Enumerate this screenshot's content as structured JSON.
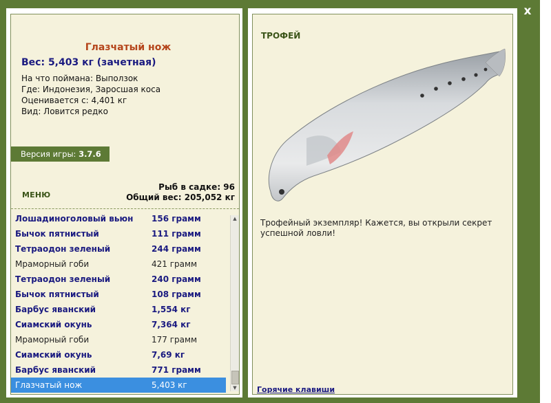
{
  "close": {
    "label": "x"
  },
  "fish": {
    "name": "Глазчатый нож",
    "weight_line": "Вес: 5,403 кг (зачетная)",
    "bait": "На что поймана: Выползок",
    "place": "Где: Индонезия, Заросшая коса",
    "rated": "Оценивается с: 4,401 кг",
    "kind": "Вид: Ловится редко"
  },
  "version": {
    "label": "Версия игры:",
    "value": "3.7.6"
  },
  "menu": {
    "label": "МЕНЮ"
  },
  "stats": {
    "fish_count": "Рыб в садке: 96",
    "total_weight": "Общий вес: 205,052 кг"
  },
  "catch_list": [
    {
      "name": "Лошадиноголовый вьюн",
      "weight": "156 грамм",
      "style": "b"
    },
    {
      "name": "Бычок пятнистый",
      "weight": "111 грамм",
      "style": "b"
    },
    {
      "name": "Тетраодон зеленый",
      "weight": "244 грамм",
      "style": "b"
    },
    {
      "name": "Мраморный гоби",
      "weight": "421 грамм",
      "style": "n"
    },
    {
      "name": "Тетраодон зеленый",
      "weight": "240 грамм",
      "style": "b"
    },
    {
      "name": "Бычок пятнистый",
      "weight": "108 грамм",
      "style": "b"
    },
    {
      "name": "Барбус яванский",
      "weight": "1,554 кг",
      "style": "b"
    },
    {
      "name": "Сиамский окунь",
      "weight": "7,364 кг",
      "style": "b"
    },
    {
      "name": "Мраморный гоби",
      "weight": "177 грамм",
      "style": "n"
    },
    {
      "name": "Сиамский окунь",
      "weight": "7,69 кг",
      "style": "b"
    },
    {
      "name": "Барбус яванский",
      "weight": "771 грамм",
      "style": "b"
    },
    {
      "name": "Глазчатый нож",
      "weight": "5,403 кг",
      "style": "sel"
    }
  ],
  "trophy": {
    "label": "ТРОФЕЙ",
    "text": "Трофейный экземпляр! Кажется, вы открыли секрет успешной ловли!"
  },
  "hotkeys": {
    "label": "Горячие клавиши"
  },
  "colors": {
    "frame": "#5d7a35",
    "panel": "#f5f2dc",
    "title": "#b5451b",
    "accent_text": "#1a1a80",
    "selection": "#3b8fe0"
  }
}
